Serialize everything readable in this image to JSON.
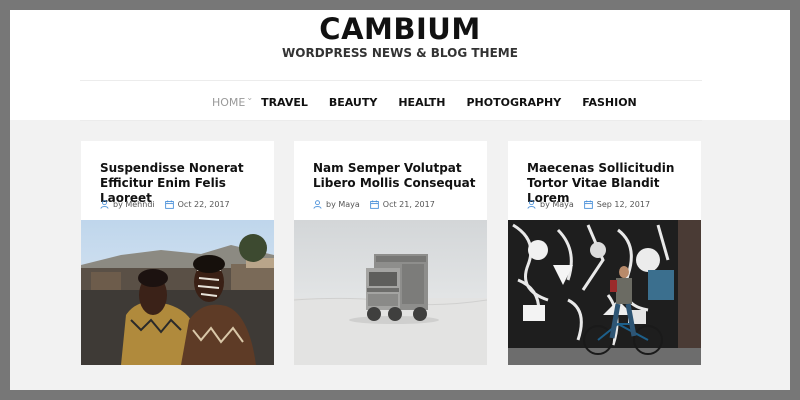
{
  "site": {
    "title": "CAMBIUM",
    "tagline": "WORDPRESS NEWS & BLOG THEME"
  },
  "nav": {
    "items": [
      {
        "label": "HOME",
        "active": true
      },
      {
        "label": "TRAVEL"
      },
      {
        "label": "BEAUTY"
      },
      {
        "label": "HEALTH"
      },
      {
        "label": "PHOTOGRAPHY"
      },
      {
        "label": "FASHION"
      }
    ]
  },
  "posts": [
    {
      "title_line1": "Suspendisse Nonerat",
      "title_line2": "Efficitur Enim Felis Laoreet",
      "author": "by Mehndi",
      "date": "Oct 22, 2017"
    },
    {
      "title_line1": "Nam Semper Volutpat",
      "title_line2": "Libero Mollis Consequat",
      "author": "by Maya",
      "date": "Oct 21, 2017"
    },
    {
      "title_line1": "Maecenas Sollicitudin",
      "title_line2": "Tortor Vitae Blandit Lorem",
      "author": "by Maya",
      "date": "Sep 12, 2017"
    }
  ],
  "colors": {
    "accent": "#4a90d9",
    "nav_active": "#999999"
  },
  "icons": {
    "author": "user-icon",
    "date": "calendar-icon",
    "submenu": "chevron-down-icon"
  }
}
